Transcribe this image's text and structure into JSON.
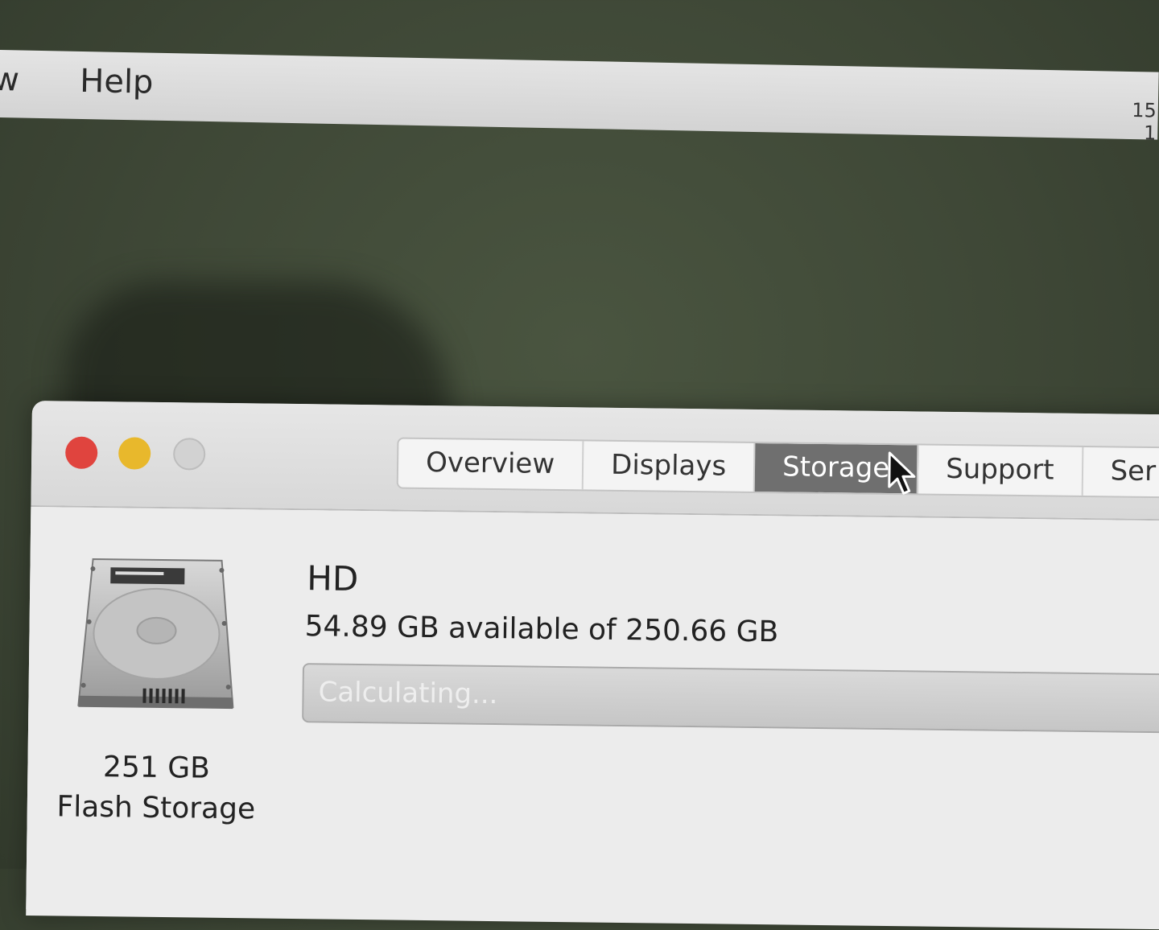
{
  "menubar": {
    "items": [
      "w",
      "Help"
    ],
    "clock_line1": "15",
    "clock_line2": "1"
  },
  "window": {
    "tabs": [
      "Overview",
      "Displays",
      "Storage",
      "Support",
      "Ser"
    ],
    "active_tab": "Storage"
  },
  "storage": {
    "disk_size": "251 GB",
    "disk_type": "Flash Storage",
    "volume_name": "HD",
    "available_text": "54.89 GB available of 250.66 GB",
    "bar_status": "Calculating..."
  },
  "colors": {
    "close": "#e0443e",
    "minimize": "#e8b82c",
    "active_tab_bg": "#6f6f6f"
  }
}
